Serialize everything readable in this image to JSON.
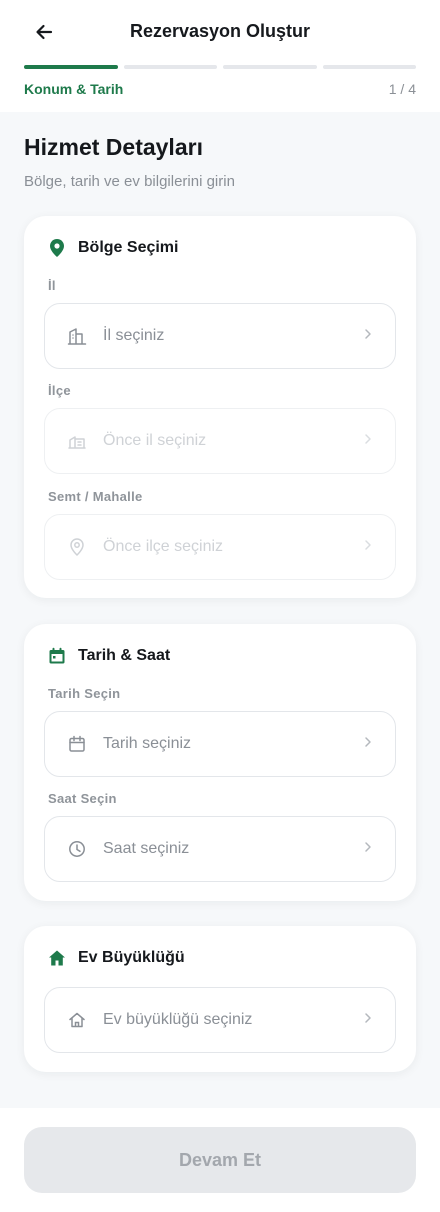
{
  "header": {
    "title": "Rezervasyon Oluştur",
    "step_label": "Konum & Tarih",
    "step_count": "1 / 4",
    "progress": {
      "current_step": 1,
      "total_steps": 4
    }
  },
  "page": {
    "title": "Hizmet Detayları",
    "subtitle": "Bölge, tarih ve ev bilgilerini girin"
  },
  "region_card": {
    "title": "Bölge Seçimi",
    "icon": "location-pin-icon",
    "fields": [
      {
        "label": "İl",
        "value": "İl seçiniz",
        "icon": "building-icon",
        "enabled": true
      },
      {
        "label": "İlçe",
        "value": "Önce il seçiniz",
        "icon": "city-icon",
        "enabled": false
      },
      {
        "label": "Semt / Mahalle",
        "value": "Önce ilçe seçiniz",
        "icon": "location-outline-icon",
        "enabled": false
      }
    ]
  },
  "datetime_card": {
    "title": "Tarih & Saat",
    "icon": "calendar-icon",
    "fields": [
      {
        "label": "Tarih Seçin",
        "value": "Tarih seçiniz",
        "icon": "calendar-outline-icon",
        "enabled": true
      },
      {
        "label": "Saat Seçin",
        "value": "Saat seçiniz",
        "icon": "clock-icon",
        "enabled": true
      }
    ]
  },
  "house_card": {
    "title": "Ev Büyüklüğü",
    "icon": "home-icon",
    "field": {
      "value": "Ev büyüklüğü seçiniz",
      "icon": "home-outline-icon",
      "enabled": true
    }
  },
  "footer": {
    "button_label": "Devam Et",
    "button_enabled": false
  },
  "colors": {
    "accent": "#1e7a4b",
    "background": "#f6f8fa",
    "disabled_button": "#e6e8eb"
  }
}
